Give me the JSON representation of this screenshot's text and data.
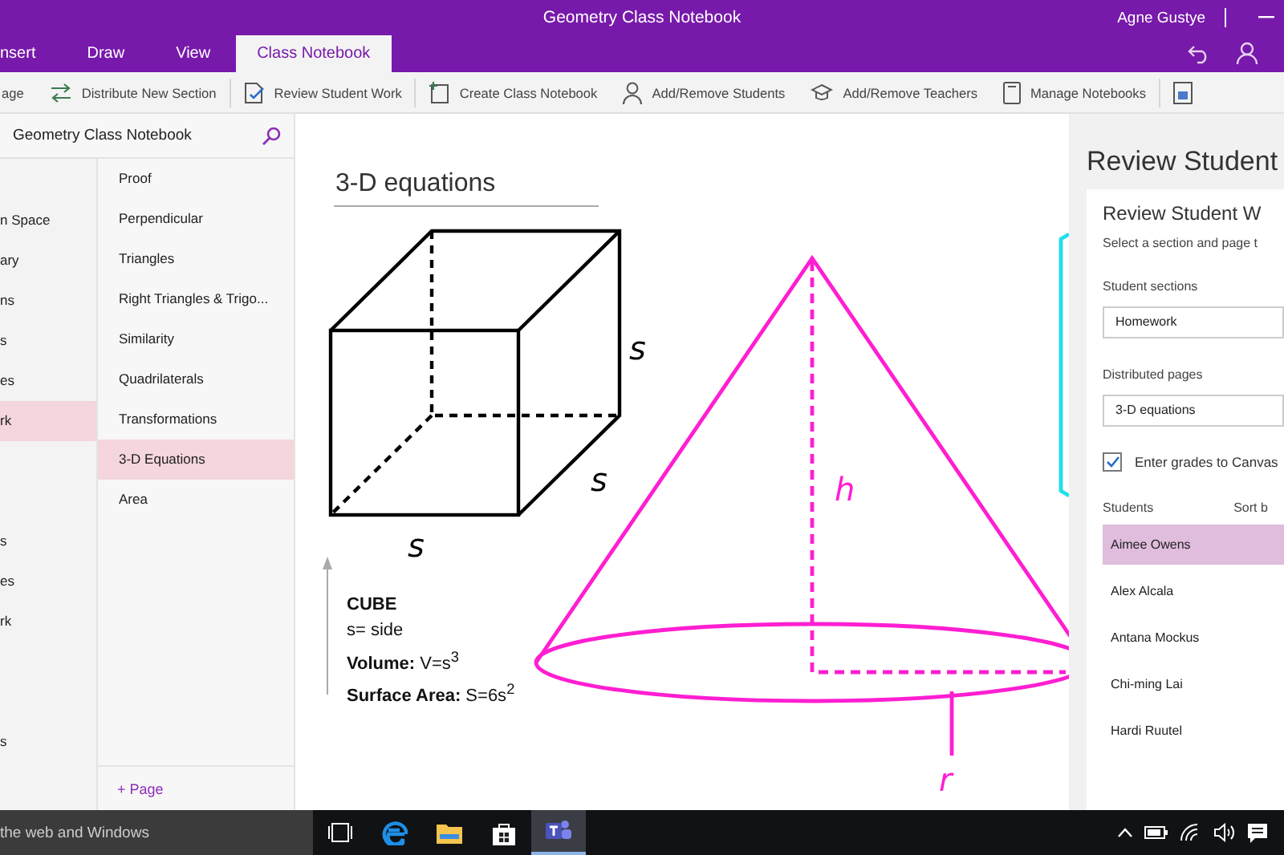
{
  "window": {
    "title": "Geometry Class Notebook",
    "user": "Agne Gustye"
  },
  "tabs": [
    {
      "label": "nsert",
      "selected": false
    },
    {
      "label": "Draw",
      "selected": false
    },
    {
      "label": "View",
      "selected": false
    },
    {
      "label": "Class Notebook",
      "selected": true
    }
  ],
  "ribbon": [
    {
      "label": "age",
      "kind": "plain"
    },
    {
      "label": "Distribute New Section",
      "kind": "distribute"
    },
    {
      "label": "Review Student Work",
      "kind": "review"
    },
    {
      "label": "Create Class Notebook",
      "kind": "create"
    },
    {
      "label": "Add/Remove Students",
      "kind": "students"
    },
    {
      "label": "Add/Remove Teachers",
      "kind": "teachers"
    },
    {
      "label": "Manage Notebooks",
      "kind": "manage"
    },
    {
      "kind": "grades"
    }
  ],
  "notebook": {
    "name": "Geometry Class Notebook"
  },
  "section_groups": [
    {
      "items": [
        {
          "label": "n Space",
          "selected": false
        },
        {
          "label": "ary",
          "selected": false
        },
        {
          "label": "ns",
          "selected": false
        },
        {
          "label": "s",
          "selected": false
        },
        {
          "label": "es",
          "selected": false
        },
        {
          "label": "rk",
          "selected": true
        }
      ]
    },
    {
      "items": [
        {
          "label": "s",
          "selected": false
        },
        {
          "label": "es",
          "selected": false
        },
        {
          "label": "rk",
          "selected": false
        }
      ]
    },
    {
      "items": [
        {
          "label": "s",
          "selected": false
        }
      ]
    }
  ],
  "pages": [
    {
      "label": "Proof",
      "selected": false
    },
    {
      "label": "Perpendicular",
      "selected": false
    },
    {
      "label": "Triangles",
      "selected": false
    },
    {
      "label": "Right Triangles & Trigo...",
      "selected": false
    },
    {
      "label": "Similarity",
      "selected": false
    },
    {
      "label": "Quadrilaterals",
      "selected": false
    },
    {
      "label": "Transformations",
      "selected": false
    },
    {
      "label": "3-D Equations",
      "selected": true
    },
    {
      "label": "Area",
      "selected": false
    }
  ],
  "add_page": "+ Page",
  "page": {
    "title": "3-D equations",
    "cube_labels": [
      "s",
      "s",
      "s"
    ],
    "cone_labels": {
      "height": "h",
      "radius": "r"
    },
    "notes": [
      "CUBE",
      "s= side",
      "**Volume:** V=s$^{3}$",
      "**Surface Area:** S=6s$^{2}$"
    ]
  },
  "review_pane": {
    "heading": "Review Student",
    "card_title": "Review Student W",
    "instruction": "Select a section and page t",
    "sections_label": "Student sections",
    "section_value": "Homework",
    "pages_label": "Distributed pages",
    "page_value": "3-D equations",
    "grades": {
      "label": "Enter grades to Canvas",
      "checked": true
    },
    "students_label": "Students",
    "sort_label": "Sort b",
    "students": [
      {
        "name": "Aimee Owens",
        "selected": true
      },
      {
        "name": "Alex Alcala",
        "selected": false
      },
      {
        "name": "Antana Mockus",
        "selected": false
      },
      {
        "name": "Chi-ming Lai",
        "selected": false
      },
      {
        "name": "Hardi Ruutel",
        "selected": false
      }
    ]
  },
  "taskbar": {
    "search": "the web and Windows",
    "apps": [
      {
        "kind": "taskview",
        "selected": false
      },
      {
        "kind": "edge",
        "selected": false
      },
      {
        "kind": "explorer",
        "selected": false
      },
      {
        "kind": "store",
        "selected": false
      },
      {
        "kind": "teams",
        "selected": true
      }
    ]
  }
}
